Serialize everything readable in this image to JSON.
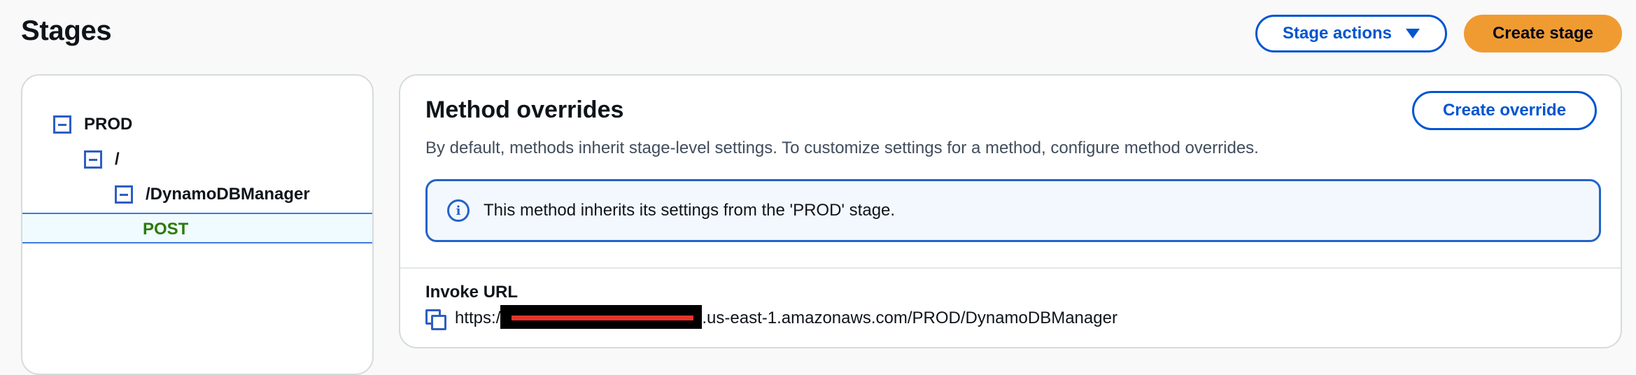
{
  "header": {
    "title": "Stages",
    "stage_actions_label": "Stage actions",
    "create_stage_label": "Create stage"
  },
  "tree": {
    "items": [
      {
        "label": "PROD"
      },
      {
        "label": "/"
      },
      {
        "label": "/DynamoDBManager"
      },
      {
        "label": "POST",
        "selected": true
      }
    ]
  },
  "method_overrides": {
    "title": "Method overrides",
    "description": "By default, methods inherit stage-level settings. To customize settings for a method, configure method overrides.",
    "create_override_label": "Create override",
    "info_text": "This method inherits its settings from the 'PROD' stage.",
    "invoke_url_label": "Invoke URL",
    "url_prefix": "https:/",
    "url_suffix": ".us-east-1.amazonaws.com/PROD/DynamoDBManager"
  },
  "colors": {
    "primary_blue": "#0055d1",
    "orange": "#f09b32",
    "post_green": "#2b7a0b"
  }
}
